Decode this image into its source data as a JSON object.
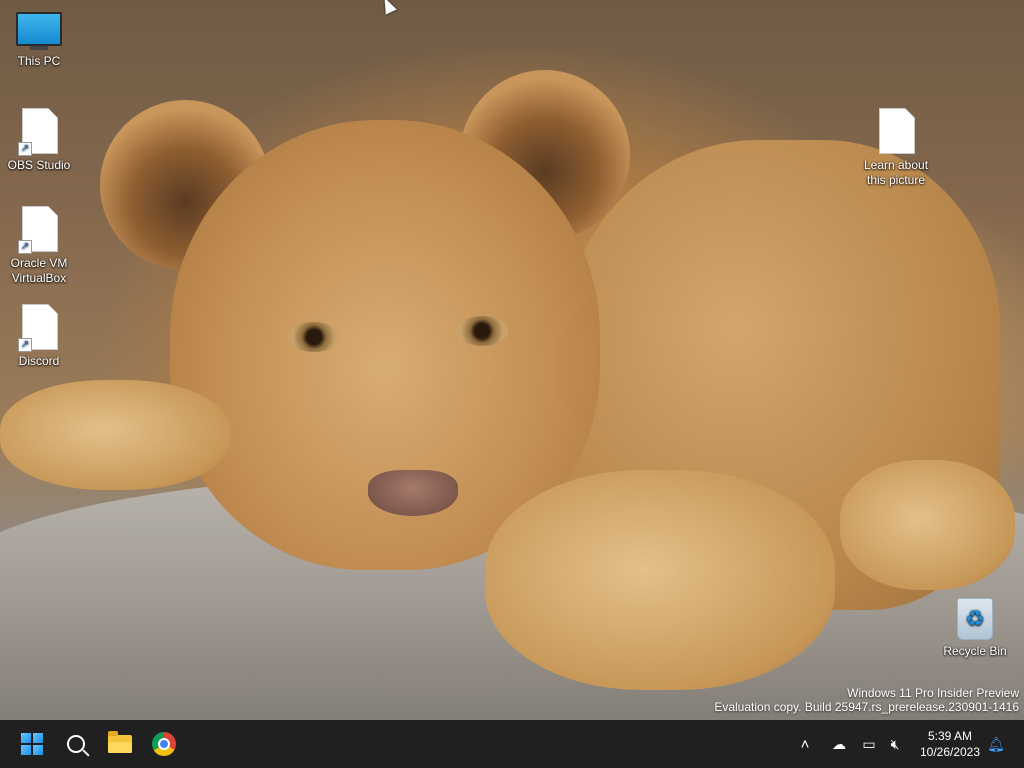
{
  "desktop_icons": [
    {
      "label": "This PC",
      "icon": "this-pc-icon"
    },
    {
      "label": "OBS Studio",
      "icon": "file-shortcut-icon"
    },
    {
      "label": "Oracle VM VirtualBox",
      "icon": "file-shortcut-icon"
    },
    {
      "label": "Discord",
      "icon": "file-shortcut-icon"
    },
    {
      "label": "Learn about this picture",
      "icon": "file-icon"
    },
    {
      "label": "Recycle Bin",
      "icon": "recycle-bin-icon"
    }
  ],
  "watermark": {
    "line1": "Windows 11 Pro Insider Preview",
    "line2": "Evaluation copy. Build 25947.rs_prerelease.230901-1416"
  },
  "taskbar": {
    "pinned": [
      {
        "name": "Start",
        "icon": "windows-start-icon"
      },
      {
        "name": "Search",
        "icon": "search-icon"
      },
      {
        "name": "File Explorer",
        "icon": "folder-icon"
      },
      {
        "name": "Google Chrome",
        "icon": "chrome-icon"
      }
    ],
    "tray": {
      "show_hidden_icon": "chevron-up-icon",
      "icons": [
        "onedrive-icon",
        "network-icon",
        "volume-muted-icon"
      ],
      "time": "5:39 AM",
      "date": "10/26/2023",
      "notifications_icon": "bell-icon"
    }
  },
  "colors": {
    "taskbar": "#202020",
    "accent": "#1a8fe8"
  }
}
